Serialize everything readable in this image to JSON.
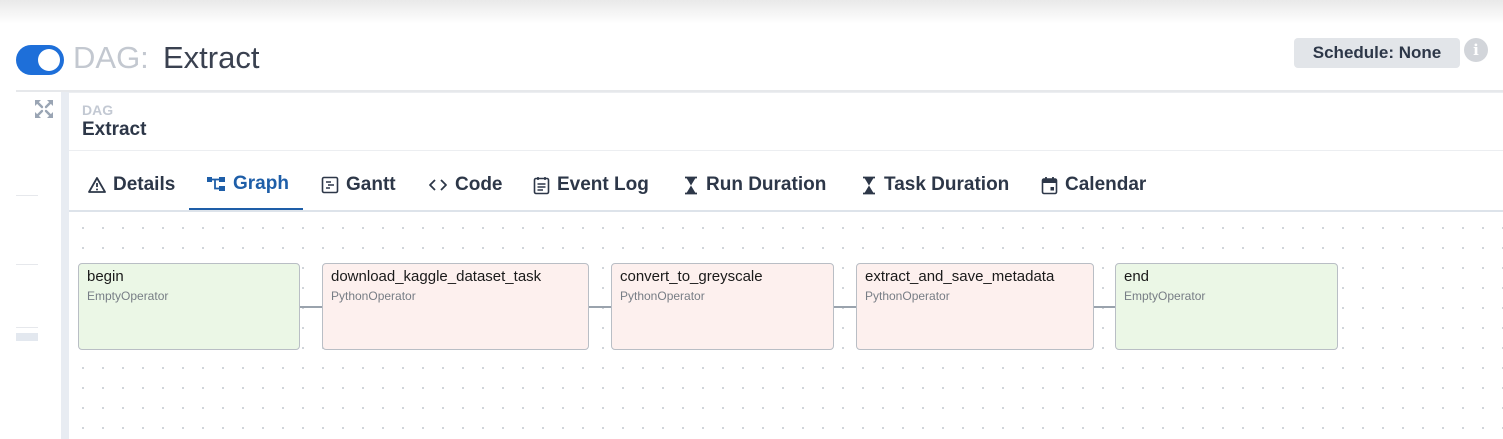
{
  "header": {
    "dag_prefix": "DAG:",
    "dag_name": "Extract",
    "schedule": "Schedule: None",
    "toggle_on": true,
    "info_icon": "i"
  },
  "panel": {
    "label": "DAG",
    "title": "Extract"
  },
  "tabs": [
    {
      "label": "Details",
      "icon": "warning-icon"
    },
    {
      "label": "Graph",
      "icon": "graph-icon",
      "active": true
    },
    {
      "label": "Gantt",
      "icon": "gantt-icon"
    },
    {
      "label": "Code",
      "icon": "code-icon"
    },
    {
      "label": "Event Log",
      "icon": "event-log-icon"
    },
    {
      "label": "Run Duration",
      "icon": "hourglass-icon"
    },
    {
      "label": "Task Duration",
      "icon": "hourglass-icon"
    },
    {
      "label": "Calendar",
      "icon": "calendar-icon"
    }
  ],
  "graph": {
    "nodes": [
      {
        "name": "begin",
        "operator": "EmptyOperator"
      },
      {
        "name": "download_kaggle_dataset_task",
        "operator": "PythonOperator"
      },
      {
        "name": "convert_to_greyscale",
        "operator": "PythonOperator"
      },
      {
        "name": "extract_and_save_metadata",
        "operator": "PythonOperator"
      },
      {
        "name": "end",
        "operator": "EmptyOperator"
      }
    ],
    "colors": {
      "EmptyOperator": "#ebf7e6",
      "PythonOperator": "#fdf0ee",
      "edge": "#9aa3ad",
      "accent": "#1e5ea8",
      "toggle": "#1e6fd9"
    }
  }
}
